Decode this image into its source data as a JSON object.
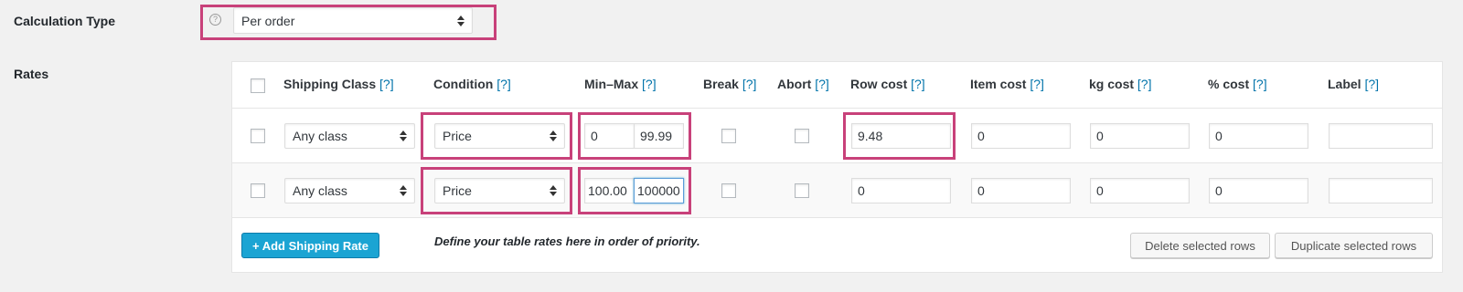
{
  "calculation_type": {
    "label": "Calculation Type",
    "help": "?",
    "value": "Per order"
  },
  "rates": {
    "label": "Rates",
    "tip": "[?]",
    "headers": {
      "shipping_class": "Shipping Class",
      "condition": "Condition",
      "min_max": "Min–Max",
      "break": "Break",
      "abort": "Abort",
      "row_cost": "Row cost",
      "item_cost": "Item cost",
      "kg_cost": "kg cost",
      "percent_cost": "% cost",
      "label": "Label"
    },
    "rows": [
      {
        "shipping_class": "Any class",
        "condition": "Price",
        "min": "0",
        "max": "99.99",
        "row_cost": "9.48",
        "item_cost": "0",
        "kg_cost": "0",
        "percent_cost": "0",
        "label": ""
      },
      {
        "shipping_class": "Any class",
        "condition": "Price",
        "min": "100.00",
        "max": "100000",
        "row_cost": "0",
        "item_cost": "0",
        "kg_cost": "0",
        "percent_cost": "0",
        "label": ""
      }
    ],
    "add_button": "+ Add Shipping Rate",
    "note": "Define your table rates here in order of priority.",
    "delete_button": "Delete selected rows",
    "duplicate_button": "Duplicate selected rows"
  },
  "colors": {
    "highlight": "#c8417a",
    "primary_button": "#1ba4d3",
    "link": "#0073aa"
  }
}
